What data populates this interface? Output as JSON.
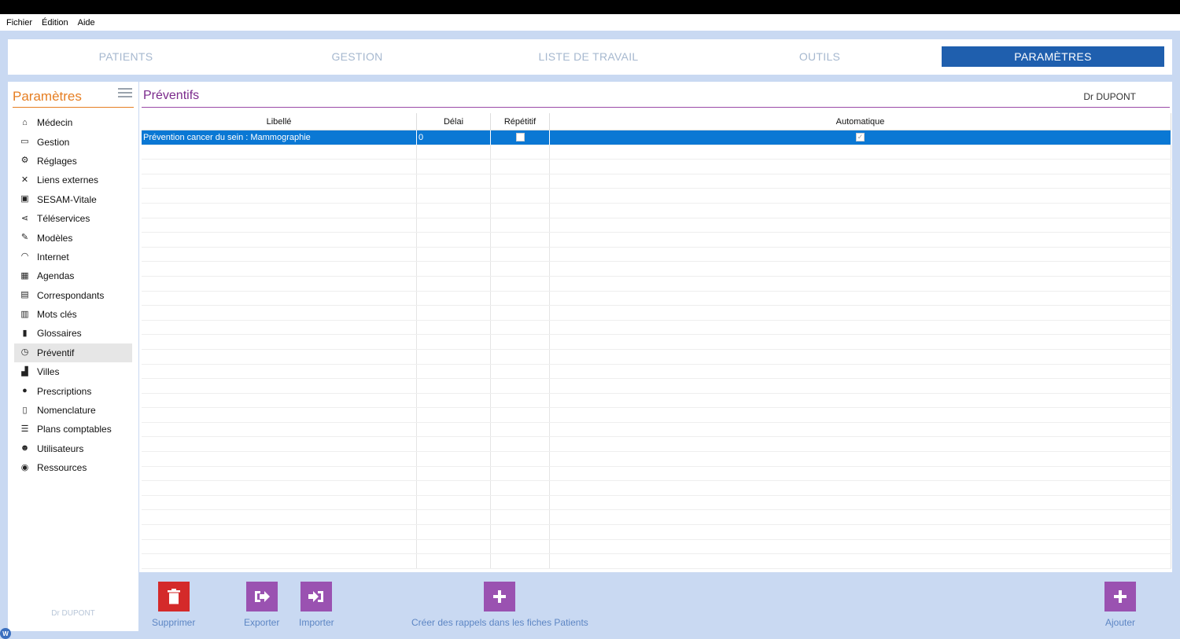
{
  "menubar": {
    "items": [
      "Fichier",
      "Édition",
      "Aide"
    ]
  },
  "tabs": [
    {
      "label": "PATIENTS",
      "active": false
    },
    {
      "label": "GESTION",
      "active": false
    },
    {
      "label": "LISTE DE TRAVAIL",
      "active": false
    },
    {
      "label": "OUTILS",
      "active": false
    },
    {
      "label": "PARAMÈTRES",
      "active": true
    }
  ],
  "sidebar": {
    "title": "Paramètres",
    "user": "Dr DUPONT",
    "items": [
      {
        "label": "Médecin",
        "icon": "home-icon"
      },
      {
        "label": "Gestion",
        "icon": "inbox-icon"
      },
      {
        "label": "Réglages",
        "icon": "cogs-icon"
      },
      {
        "label": "Liens externes",
        "icon": "expand-icon"
      },
      {
        "label": "SESAM-Vitale",
        "icon": "card-icon"
      },
      {
        "label": "Téléservices",
        "icon": "share-icon"
      },
      {
        "label": "Modèles",
        "icon": "edit-icon"
      },
      {
        "label": "Internet",
        "icon": "wifi-icon"
      },
      {
        "label": "Agendas",
        "icon": "calendar-icon"
      },
      {
        "label": "Correspondants",
        "icon": "contact-book-icon"
      },
      {
        "label": "Mots clés",
        "icon": "bar-chart-icon"
      },
      {
        "label": "Glossaires",
        "icon": "clipboard-icon"
      },
      {
        "label": "Préventif",
        "icon": "clock-icon",
        "selected": true
      },
      {
        "label": "Villes",
        "icon": "city-icon"
      },
      {
        "label": "Prescriptions",
        "icon": "pills-icon"
      },
      {
        "label": "Nomenclature",
        "icon": "document-icon"
      },
      {
        "label": "Plans comptables",
        "icon": "list-icon"
      },
      {
        "label": "Utilisateurs",
        "icon": "users-icon"
      },
      {
        "label": "Ressources",
        "icon": "binoculars-icon"
      }
    ]
  },
  "main": {
    "title": "Préventifs",
    "user": "Dr DUPONT",
    "columns": [
      "Libellé",
      "Délai",
      "Répétitif",
      "Automatique"
    ],
    "rows": [
      {
        "libelle": "Prévention cancer du sein : Mammographie",
        "delai": "0",
        "repetitif": false,
        "automatique": true
      }
    ]
  },
  "actions": {
    "delete": "Supprimer",
    "export": "Exporter",
    "import": "Importer",
    "create_reminders": "Créer des rappels dans les fiches Patients",
    "add": "Ajouter"
  },
  "colors": {
    "tab_active": "#1f5fae",
    "sidebar_title": "#e67e22",
    "main_title": "#7b2a8c",
    "selection": "#0a78d4",
    "delete_button": "#d42a2a",
    "action_button": "#9a52b1",
    "app_background": "#c9d9f2"
  }
}
